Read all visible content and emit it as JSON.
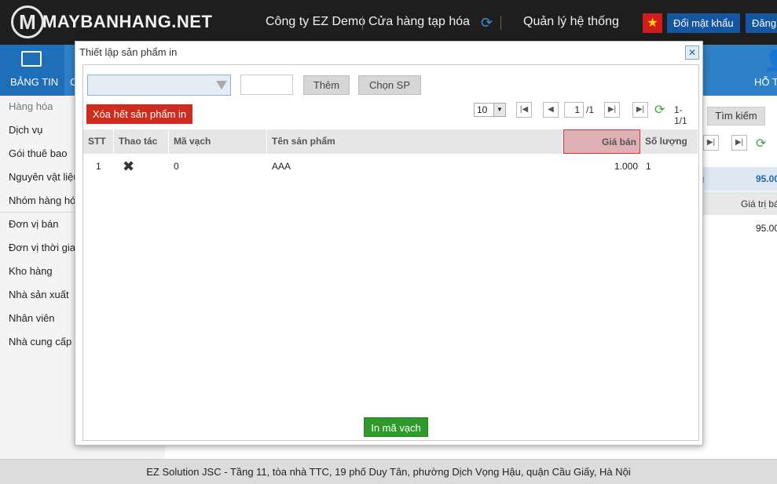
{
  "header": {
    "logo_text": "MAYBANHANG.NET",
    "company": "Công ty EZ Demo",
    "store": "Cửa hàng tạp hóa",
    "system_admin": "Quản lý hệ thống",
    "change_password": "Đổi mật khẩu",
    "logout": "Đăng",
    "flag_icon": "vietnam-flag-icon",
    "refresh_icon": "refresh-icon"
  },
  "nav": {
    "dashboard": "BẢNG TIN",
    "cut_item": "C",
    "support": "HỖ T"
  },
  "sidebar": {
    "items": [
      {
        "label": "Hàng hóa"
      },
      {
        "label": "Dịch vụ"
      },
      {
        "label": "Gói thuê bao"
      },
      {
        "label": "Nguyên vật liệu"
      },
      {
        "label": "Nhóm hàng hóa"
      },
      {
        "label": "Đơn vị bán"
      },
      {
        "label": "Đơn vị thời gian"
      },
      {
        "label": "Kho hàng"
      },
      {
        "label": "Nhà sản xuất"
      },
      {
        "label": "Nhân viên"
      },
      {
        "label": "Nhà cung cấp"
      }
    ]
  },
  "background": {
    "search_button": "Tìm kiếm",
    "row1_col1": "g",
    "row1_col2": "95.00",
    "header_col1": "m",
    "header_col2": "Giá trị bá",
    "val1": "5",
    "val2": "95.00"
  },
  "modal": {
    "title": "Thiết lập sản phẩm in",
    "product_select_value": "",
    "quantity_value": "",
    "add_button": "Thêm",
    "choose_product_button": "Chọn SP",
    "clear_button": "Xóa hết sản phẩm in",
    "pager": {
      "page_size": "10",
      "current_page": "1",
      "total_pages": "/1",
      "range": "1-1/1"
    },
    "columns": [
      "STT",
      "Thao tác",
      "Mã vạch",
      "Tên sản phẩm",
      "Giá bán",
      "Số lượng"
    ],
    "rows": [
      {
        "stt": "1",
        "barcode": "0",
        "name": "AAA",
        "price": "1.000",
        "qty": "1"
      }
    ],
    "print_button": "In mã vạch"
  },
  "footer": {
    "text": "EZ Solution JSC - Tầng 11, tòa nhà TTC, 19 phố Duy Tân, phường Dịch Vọng Hậu, quận Cầu Giấy, Hà Nội"
  },
  "colors": {
    "topbar": "#1e1e1e",
    "nav": "#2e80c7",
    "danger": "#cf2b1e",
    "success": "#2e9a2a",
    "sorted_header": "#dfb1b4"
  }
}
